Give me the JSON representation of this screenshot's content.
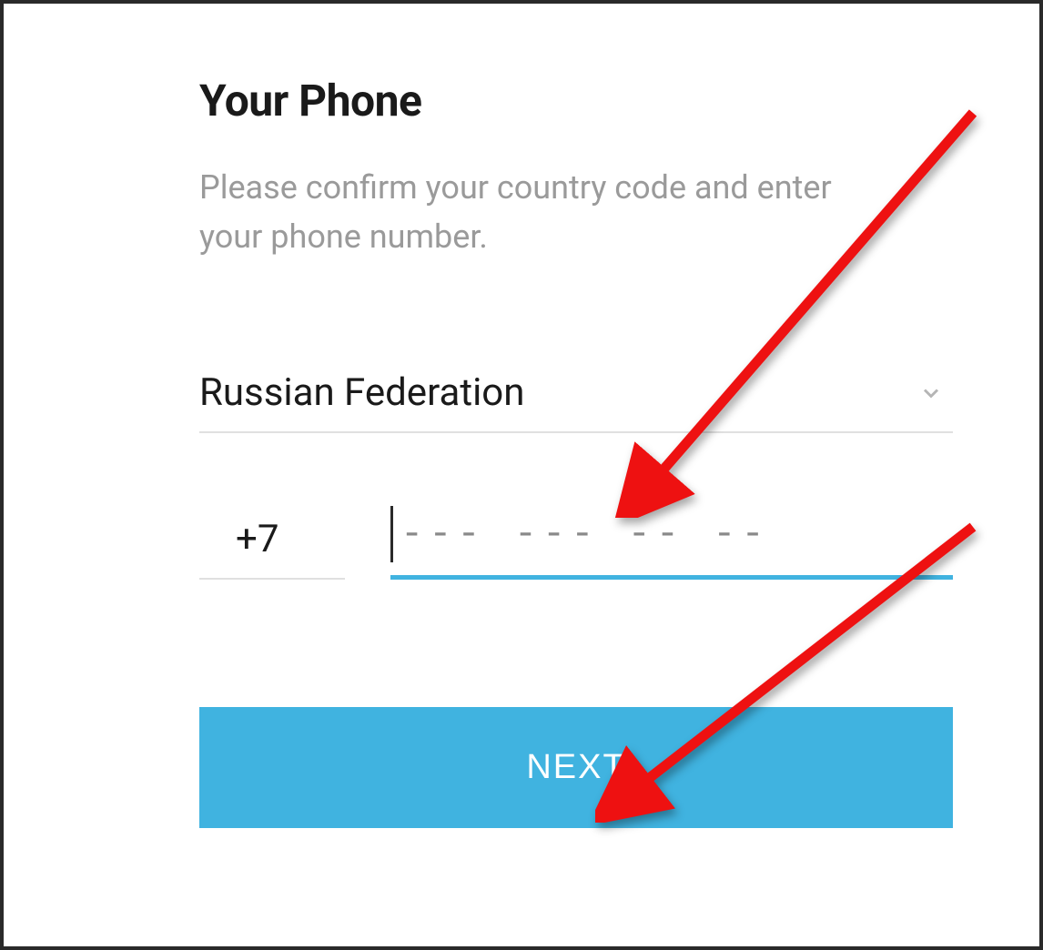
{
  "title": "Your Phone",
  "subtitle": "Please confirm your country code and enter your phone number.",
  "country": {
    "selected": "Russian Federation",
    "code": "+7"
  },
  "phone": {
    "placeholder": "--- --- -- --"
  },
  "next_label": "NEXT"
}
